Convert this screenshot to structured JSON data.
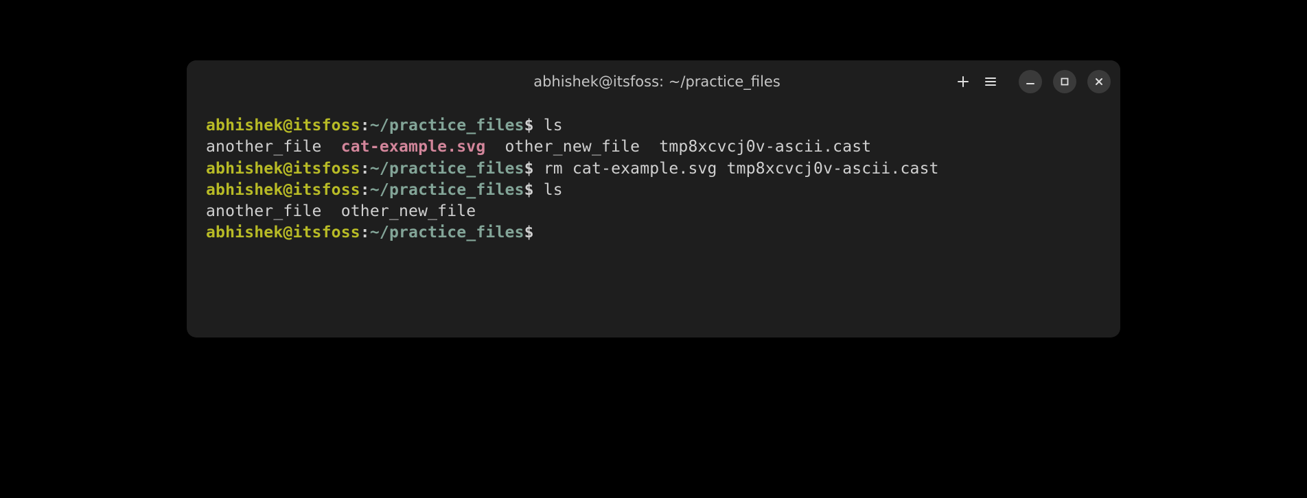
{
  "titlebar": {
    "title": "abhishek@itsfoss: ~/practice_files"
  },
  "prompt": {
    "user": "abhishek",
    "at": "@",
    "host": "itsfoss",
    "colon": ":",
    "path": "~/practice_files",
    "dollar": "$"
  },
  "lines": {
    "l1_cmd": " ls",
    "l2_f1": "another_file",
    "l2_f2": "cat-example.svg",
    "l2_f3": "other_new_file",
    "l2_f4": "tmp8xcvcj0v-ascii.cast",
    "l3_cmd": " rm cat-example.svg tmp8xcvcj0v-ascii.cast",
    "l4_cmd": " ls",
    "l5_f1": "another_file",
    "l5_f2": "other_new_file",
    "l6_cmd": " "
  },
  "sep2": "  "
}
